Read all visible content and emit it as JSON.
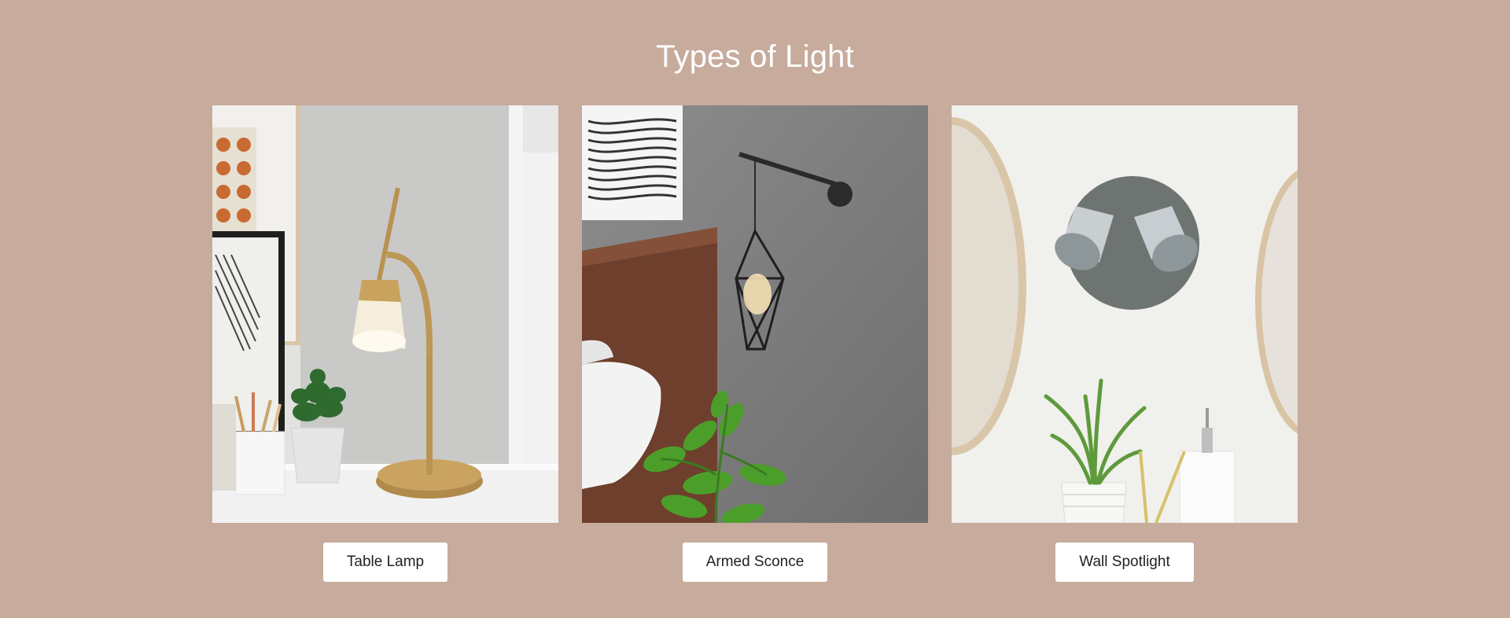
{
  "section": {
    "title": "Types of Light",
    "cards": [
      {
        "image_subject": "table-lamp-photo",
        "button_label": "Table Lamp"
      },
      {
        "image_subject": "armed-sconce-photo",
        "button_label": "Armed Sconce"
      },
      {
        "image_subject": "wall-spotlight-photo",
        "button_label": "Wall Spotlight"
      }
    ]
  },
  "colors": {
    "background": "#c7ab9c",
    "title_text": "#ffffff",
    "button_bg": "#ffffff",
    "button_text": "#222222"
  }
}
